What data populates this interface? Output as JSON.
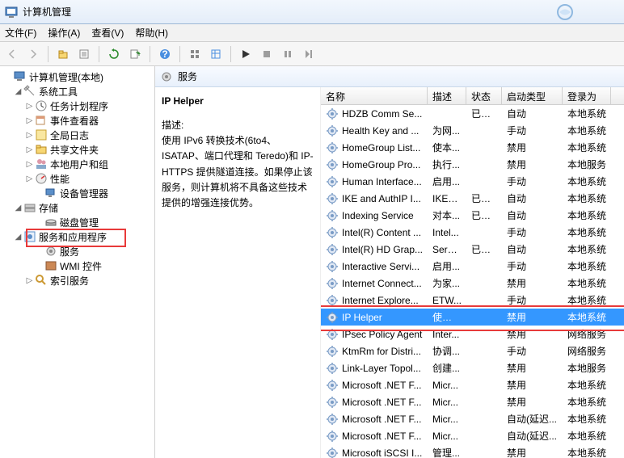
{
  "title": "计算机管理",
  "menu": {
    "file": "文件(F)",
    "action": "操作(A)",
    "view": "查看(V)",
    "help": "帮助(H)"
  },
  "tree": {
    "root": "计算机管理(本地)",
    "systools": "系统工具",
    "scheduler": "任务计划程序",
    "eventviewer": "事件查看器",
    "sharedfolders": "全局日志",
    "shared": "共享文件夹",
    "localusers": "本地用户和组",
    "perf": "性能",
    "devmgr": "设备管理器",
    "storage": "存储",
    "diskmgmt": "磁盘管理",
    "svcapps": "服务和应用程序",
    "services": "服务",
    "wmi": "WMI 控件",
    "indexing": "索引服务"
  },
  "rightHeader": "服务",
  "detail": {
    "name": "IP Helper",
    "descLabel": "描述:",
    "desc": "使用 IPv6 转换技术(6to4、ISATAP、端口代理和 Teredo)和 IP-HTTPS 提供隧道连接。如果停止该服务，则计算机将不具备这些技术提供的增强连接优势。"
  },
  "columns": {
    "name": "名称",
    "desc": "描述",
    "status": "状态",
    "startup": "启动类型",
    "logon": "登录为"
  },
  "services": [
    {
      "name": "HDZB Comm Se...",
      "desc": "",
      "status": "已启动",
      "startup": "自动",
      "logon": "本地系统"
    },
    {
      "name": "Health Key and ...",
      "desc": "为网...",
      "status": "",
      "startup": "手动",
      "logon": "本地系统"
    },
    {
      "name": "HomeGroup List...",
      "desc": "使本...",
      "status": "",
      "startup": "禁用",
      "logon": "本地系统"
    },
    {
      "name": "HomeGroup Pro...",
      "desc": "执行...",
      "status": "",
      "startup": "禁用",
      "logon": "本地服务"
    },
    {
      "name": "Human Interface...",
      "desc": "启用...",
      "status": "",
      "startup": "手动",
      "logon": "本地系统"
    },
    {
      "name": "IKE and AuthIP I...",
      "desc": "IKEE...",
      "status": "已启动",
      "startup": "自动",
      "logon": "本地系统"
    },
    {
      "name": "Indexing Service",
      "desc": "对本...",
      "status": "已启动",
      "startup": "自动",
      "logon": "本地系统"
    },
    {
      "name": "Intel(R) Content ...",
      "desc": "Intel...",
      "status": "",
      "startup": "手动",
      "logon": "本地系统"
    },
    {
      "name": "Intel(R) HD Grap...",
      "desc": "Servi...",
      "status": "已启动",
      "startup": "自动",
      "logon": "本地系统"
    },
    {
      "name": "Interactive Servi...",
      "desc": "启用...",
      "status": "",
      "startup": "手动",
      "logon": "本地系统"
    },
    {
      "name": "Internet Connect...",
      "desc": "为家...",
      "status": "",
      "startup": "禁用",
      "logon": "本地系统"
    },
    {
      "name": "Internet Explore...",
      "desc": "ETW...",
      "status": "",
      "startup": "手动",
      "logon": "本地系统"
    },
    {
      "name": "IP Helper",
      "desc": "使用 ...",
      "status": "",
      "startup": "禁用",
      "logon": "本地系统",
      "selected": true
    },
    {
      "name": "IPsec Policy Agent",
      "desc": "Inter...",
      "status": "",
      "startup": "禁用",
      "logon": "网络服务"
    },
    {
      "name": "KtmRm for Distri...",
      "desc": "协调...",
      "status": "",
      "startup": "手动",
      "logon": "网络服务"
    },
    {
      "name": "Link-Layer Topol...",
      "desc": "创建...",
      "status": "",
      "startup": "禁用",
      "logon": "本地服务"
    },
    {
      "name": "Microsoft .NET F...",
      "desc": "Micr...",
      "status": "",
      "startup": "禁用",
      "logon": "本地系统"
    },
    {
      "name": "Microsoft .NET F...",
      "desc": "Micr...",
      "status": "",
      "startup": "禁用",
      "logon": "本地系统"
    },
    {
      "name": "Microsoft .NET F...",
      "desc": "Micr...",
      "status": "",
      "startup": "自动(延迟...",
      "logon": "本地系统"
    },
    {
      "name": "Microsoft .NET F...",
      "desc": "Micr...",
      "status": "",
      "startup": "自动(延迟...",
      "logon": "本地系统"
    },
    {
      "name": "Microsoft iSCSI I...",
      "desc": "管理...",
      "status": "",
      "startup": "禁用",
      "logon": "本地系统"
    }
  ]
}
